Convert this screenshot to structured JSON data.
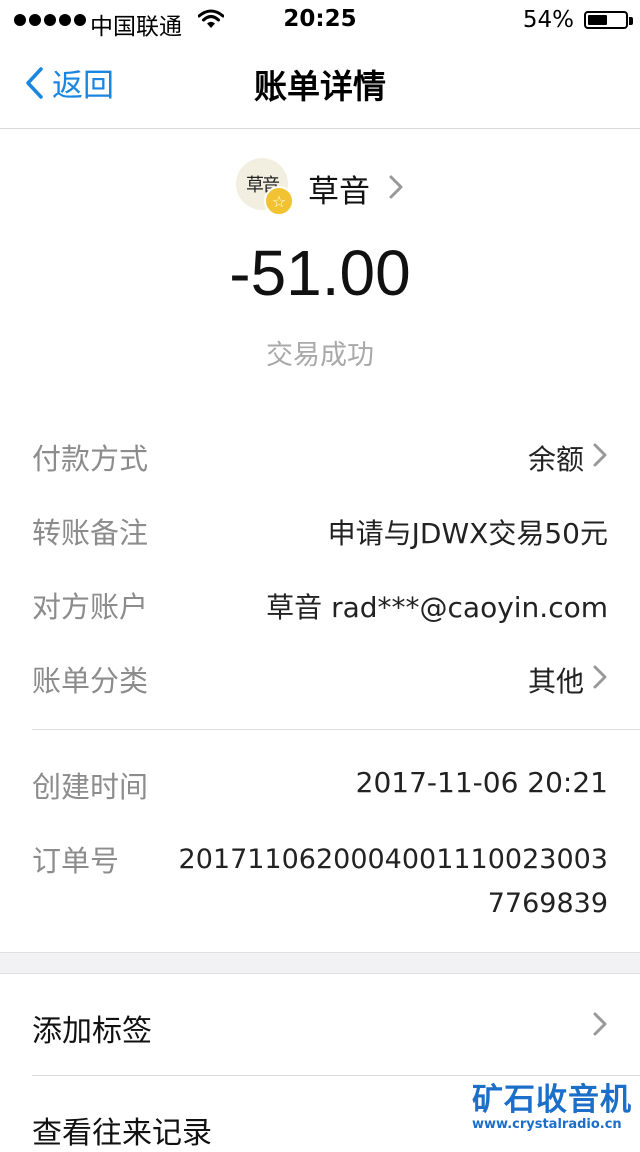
{
  "status_bar": {
    "carrier": "中国联通",
    "time": "20:25",
    "battery": "54%",
    "battery_level": 0.54
  },
  "nav": {
    "back_label": "返回",
    "title": "账单详情"
  },
  "header": {
    "avatar_text": "草音",
    "merchant": "草音",
    "amount": "-51.00",
    "status": "交易成功"
  },
  "details": {
    "payment_method": {
      "label": "付款方式",
      "value": "余额"
    },
    "transfer_note": {
      "label": "转账备注",
      "value": "申请与JDWX交易50元"
    },
    "counterparty": {
      "label": "对方账户",
      "value": "草音 rad***@caoyin.com"
    },
    "category": {
      "label": "账单分类",
      "value": "其他"
    },
    "created_time": {
      "label": "创建时间",
      "value": "2017-11-06 20:21"
    },
    "order_no": {
      "label": "订单号",
      "value": "20171106200040011100230037769839"
    }
  },
  "actions": {
    "add_tag": "添加标签",
    "view_history": "查看往来记录"
  },
  "watermark": {
    "title": "矿石收音机",
    "url": "www.crystalradio.cn"
  },
  "colors": {
    "accent": "#1a86e0",
    "label_gray": "#8c8c8c",
    "badge_gold": "#f1c232",
    "watermark_blue": "#1c6fc9"
  }
}
